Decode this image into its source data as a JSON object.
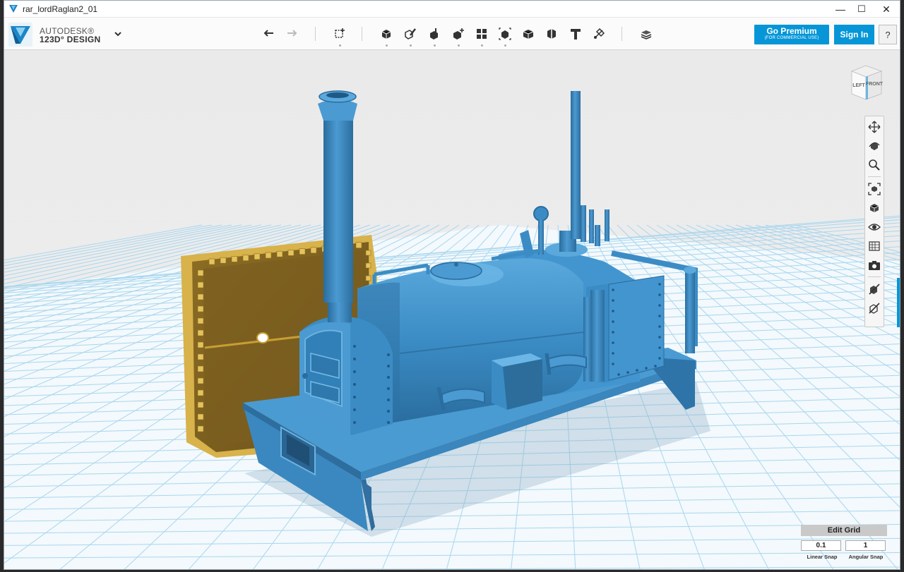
{
  "window": {
    "title": "rar_lordRaglan2_01",
    "minimize_glyph": "—",
    "maximize_glyph": "☐",
    "close_glyph": "✕"
  },
  "brand": {
    "line1": "AUTODESK®",
    "line2": "123D° DESIGN",
    "logo_icon": "autodesk-123d-logo",
    "menu_icon": "chevron-down-icon"
  },
  "toolbar": {
    "undo_icon": "undo-icon",
    "redo_icon": "redo-icon",
    "tools": [
      {
        "name": "transform-tool",
        "icon": "transform-icon"
      },
      {
        "name": "primitives-tool",
        "icon": "primitives-icon"
      },
      {
        "name": "sketch-tool",
        "icon": "sketch-icon"
      },
      {
        "name": "construct-tool",
        "icon": "construct-icon"
      },
      {
        "name": "modify-tool",
        "icon": "modify-icon"
      },
      {
        "name": "pattern-tool",
        "icon": "pattern-icon"
      },
      {
        "name": "group-tool",
        "icon": "group-icon"
      },
      {
        "name": "combine-tool",
        "icon": "combine-icon"
      },
      {
        "name": "measure-tool",
        "icon": "measure-icon"
      },
      {
        "name": "text-tool",
        "icon": "text-icon"
      },
      {
        "name": "snap-tool",
        "icon": "snap-icon"
      },
      {
        "name": "material-tool",
        "icon": "material-icon"
      }
    ],
    "premium_label": "Go Premium",
    "premium_sub": "(FOR COMMERCIAL USE)",
    "signin_label": "Sign In",
    "help_label": "?"
  },
  "viewcube": {
    "left_face": "LEFT",
    "front_face": "FRONT"
  },
  "navbar": {
    "items": [
      "pan-icon",
      "orbit-icon",
      "zoom-icon",
      "fit-icon",
      "views-icon",
      "visibility-icon",
      "materials-outlines-icon",
      "screenshot-icon",
      "hide-sketches-icon",
      "hide-mesh-icon"
    ]
  },
  "grid": {
    "edit_label": "Edit Grid",
    "linear_snap_value": "0.1",
    "angular_snap_value": "1",
    "linear_snap_label": "Linear Snap",
    "angular_snap_label": "Angular Snap"
  },
  "colors": {
    "accent": "#0696d7",
    "model_blue": "#3d8fc6",
    "model_blue_dark": "#2c6d9b",
    "door_gold": "#c9a23c",
    "grid_line": "#9fd0ea"
  }
}
